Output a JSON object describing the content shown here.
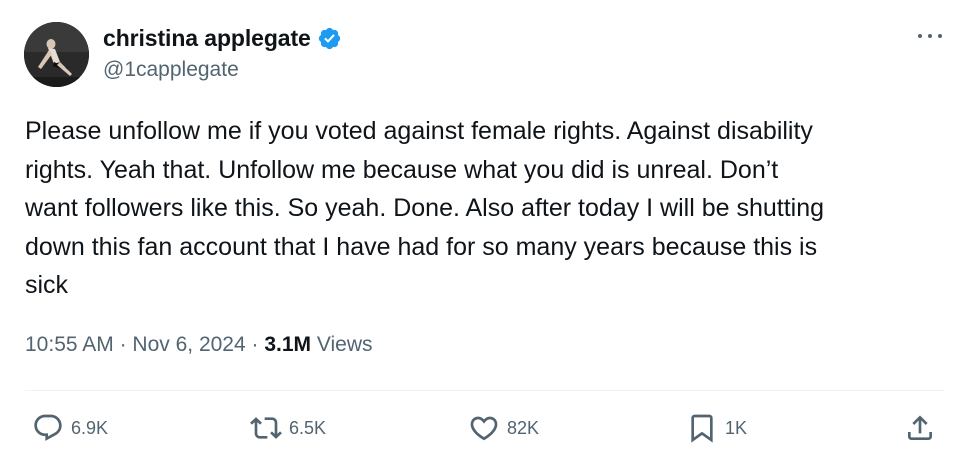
{
  "author": {
    "display_name": "christina applegate",
    "handle": "@1capplegate",
    "verified_icon": "verified-badge-icon",
    "verified_color": "#1d9bf0"
  },
  "tweet": {
    "text": "Please unfollow me if you voted against female rights. Against disability\nrights. Yeah that. Unfollow me because what you did is unreal. Don’t\nwant followers like this. So yeah. Done. Also after today I will be shutting\ndown this fan account that I have had for so many years because this is\nsick",
    "time": "10:55 AM",
    "separator": "·",
    "date": "Nov 6, 2024",
    "views_count": "3.1M",
    "views_label": "Views"
  },
  "actions": {
    "reply": {
      "icon": "reply-icon",
      "count": "6.9K"
    },
    "retweet": {
      "icon": "retweet-icon",
      "count": "6.5K"
    },
    "like": {
      "icon": "heart-icon",
      "count": "82K"
    },
    "bookmark": {
      "icon": "bookmark-icon",
      "count": "1K"
    },
    "share": {
      "icon": "share-icon"
    }
  },
  "colors": {
    "text": "#0f1419",
    "secondary": "#536471",
    "divider": "#eff3f4"
  }
}
